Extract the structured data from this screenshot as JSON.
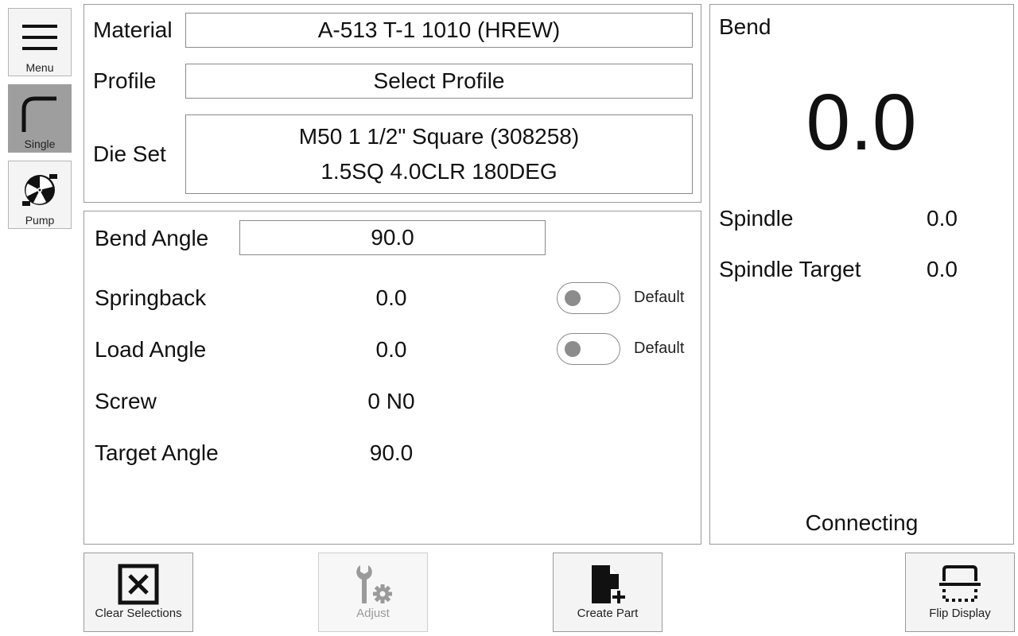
{
  "nav": {
    "menu_label": "Menu",
    "single_label": "Single",
    "pump_label": "Pump",
    "menu_icon": "hamburger-icon",
    "single_icon": "bend-corner-icon",
    "pump_icon": "pump-icon"
  },
  "setup": {
    "material_label": "Material",
    "material_value": "A-513 T-1 1010 (HREW)",
    "profile_label": "Profile",
    "profile_value": "Select Profile",
    "dieset_label": "Die Set",
    "dieset_line1": "M50 1 1/2\" Square (308258)",
    "dieset_line2": "1.5SQ 4.0CLR 180DEG"
  },
  "bend": {
    "bend_angle_label": "Bend Angle",
    "bend_angle_value": "90.0",
    "springback_label": "Springback",
    "springback_value": "0.0",
    "springback_toggle_label": "Default",
    "load_angle_label": "Load Angle",
    "load_angle_value": "0.0",
    "load_angle_toggle_label": "Default",
    "screw_label": "Screw",
    "screw_value": "0 N0",
    "target_angle_label": "Target Angle",
    "target_angle_value": "90.0"
  },
  "status": {
    "title": "Bend",
    "readout": "0.0",
    "spindle_label": "Spindle",
    "spindle_value": "0.0",
    "spindle_target_label": "Spindle Target",
    "spindle_target_value": "0.0",
    "connection": "Connecting"
  },
  "actions": {
    "clear_label": "Clear Selections",
    "adjust_label": "Adjust",
    "create_label": "Create Part",
    "flip_label": "Flip Display"
  },
  "colors": {
    "active_nav": "#9e9e9e",
    "panel_border": "#9a9a9a",
    "disabled_text": "#9a9a9a"
  }
}
